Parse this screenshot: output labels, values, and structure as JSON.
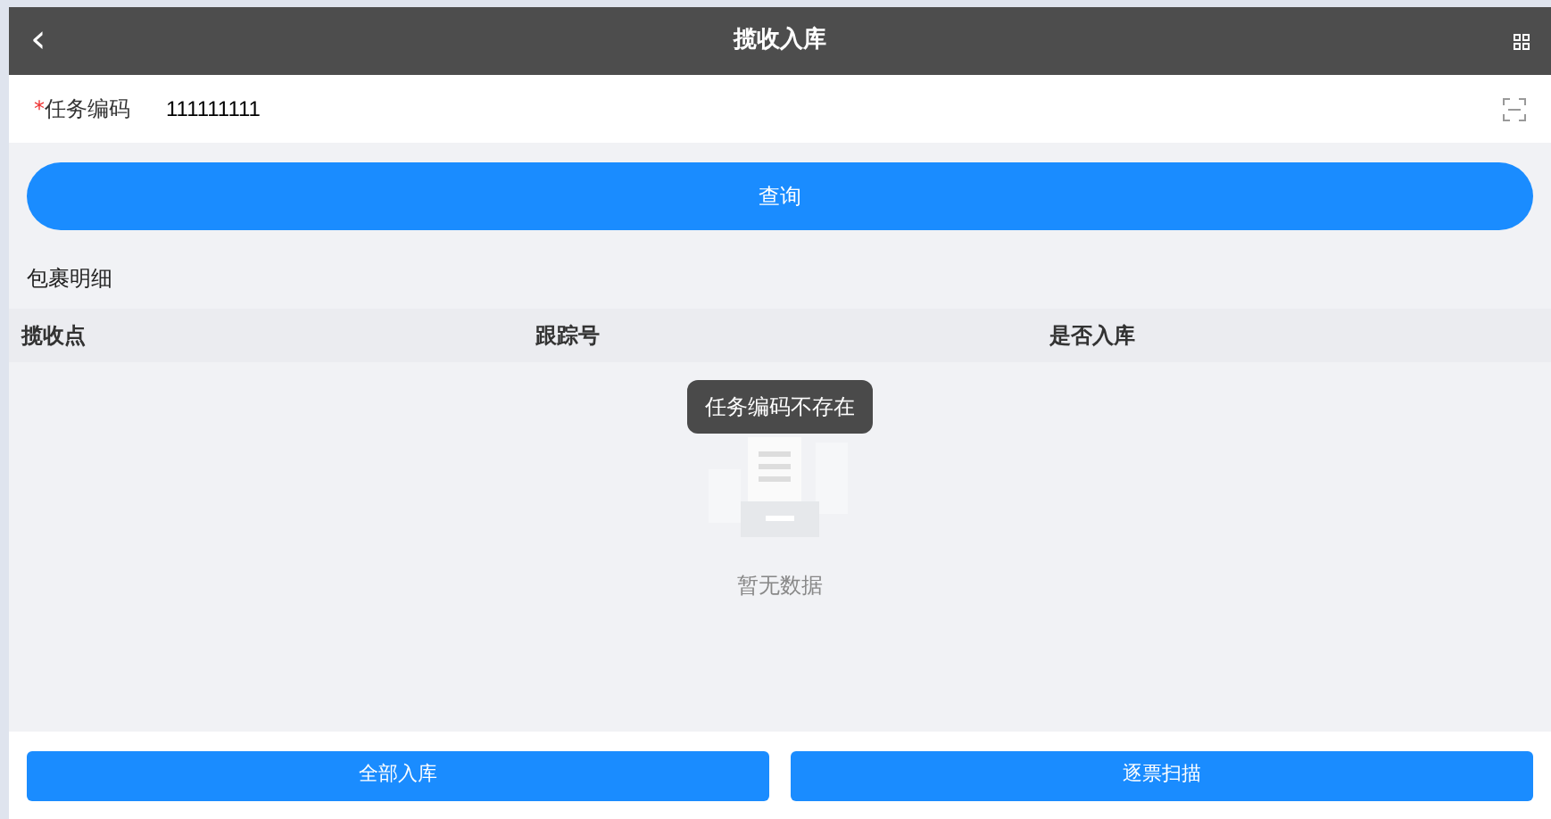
{
  "header": {
    "back": "‹",
    "title": "揽收入库"
  },
  "field": {
    "required": "*",
    "label": "任务编码",
    "value": "111111111"
  },
  "query_button": "查询",
  "section_title": "包裹明细",
  "table": {
    "columns": [
      "揽收点",
      "跟踪号",
      "是否入库"
    ],
    "empty_text": "暂无数据"
  },
  "toast": "任务编码不存在",
  "footer_buttons": [
    "全部入库",
    "逐票扫描"
  ]
}
